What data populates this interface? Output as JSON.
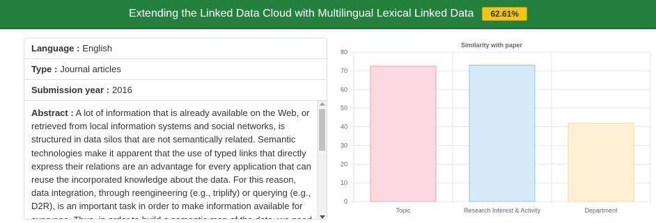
{
  "header": {
    "title": "Extending the Linked Data Cloud with Multilingual Lexical Linked Data",
    "score": "62.61%",
    "bg_color": "#24803d",
    "badge_color": "#f0c419"
  },
  "info": {
    "language_label": "Language :",
    "language_value": "English",
    "type_label": "Type :",
    "type_value": "Journal articles",
    "year_label": "Submission year :",
    "year_value": "2016",
    "abstract_label": "Abstract :",
    "abstract_text": "A lot of information that is already available on the Web, or retrieved from local information systems and social networks, is structured in data silos that are not semantically related. Semantic technologies make it apparent that the use of typed links that directly express their relations are an advantage for every application that can reuse the incorporated knowledge about the data. For this reason, data integration, through reengineering (e.g., triplify) or querying (e.g., D2R), is an important task in order to make information available for everyone. Thus, in order to build a semantic map of the data, we need"
  },
  "chart_data": {
    "type": "bar",
    "title": "Similarity with paper",
    "categories": [
      "Topic",
      "Research Interest & Activity",
      "Department"
    ],
    "values": [
      72.5,
      73,
      42
    ],
    "ylim": [
      0,
      80
    ],
    "yticks": [
      0,
      10,
      20,
      30,
      40,
      50,
      60,
      70,
      80
    ],
    "grid": true,
    "colors": [
      {
        "fill": "#fbd9e0",
        "stroke": "#f3a0b2"
      },
      {
        "fill": "#d6e9f7",
        "stroke": "#8ec3ea"
      },
      {
        "fill": "#fdf0d5",
        "stroke": "#f9d98f"
      }
    ]
  }
}
